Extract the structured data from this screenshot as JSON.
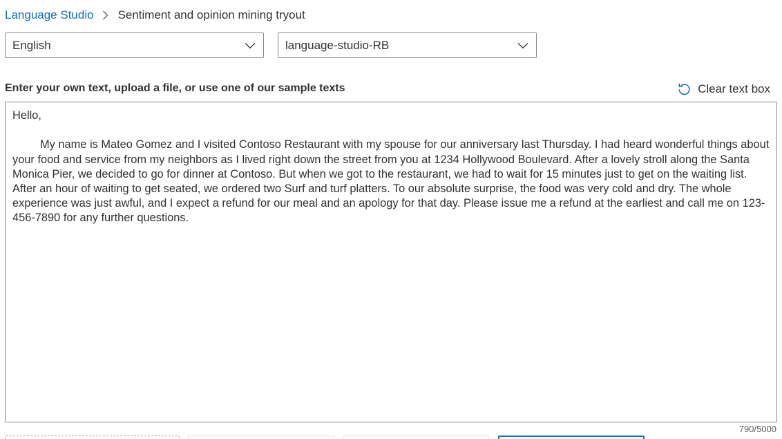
{
  "breadcrumb": {
    "root": "Language Studio",
    "current": "Sentiment and opinion mining tryout"
  },
  "language_select": {
    "value": "English"
  },
  "resource_select": {
    "value": "language-studio-RB"
  },
  "input_section": {
    "label": "Enter your own text, upload a file, or use one of our sample texts",
    "clear_label": "Clear text box",
    "text_greeting": "Hello,",
    "text_body": "My name is Mateo Gomez and I visited Contoso Restaurant with my spouse for our anniversary last Thursday. I had heard wonderful things about your food and service from my neighbors as I lived right down the street from you at 1234 Hollywood Boulevard. After a lovely stroll along the Santa Monica Pier, we decided to go for dinner at Contoso. But when we got to the restaurant, we had to wait for 15 minutes just to get on the waiting list. After an hour of waiting to get seated, we ordered two Surf and turf platters. To our absolute surprise, the food was very cold and dry. The whole experience was just awful, and I expect a refund for our meal and an apology for that day. Please issue me a refund at the earliest and call me on 123-456-7890 for any further questions.",
    "char_count": "790/5000"
  },
  "icons": {
    "breadcrumb_separator": "chevron-right-icon",
    "dropdown": "chevron-down-icon",
    "clear": "undo-icon"
  },
  "colors": {
    "accent": "#0f6cbd",
    "text": "#323130",
    "border": "#8a8886"
  }
}
